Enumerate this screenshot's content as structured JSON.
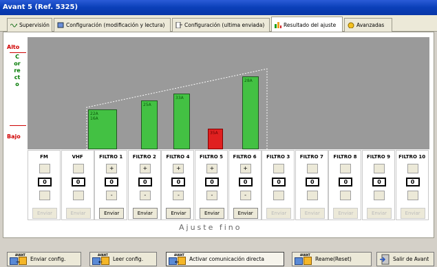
{
  "window": {
    "title": "Avant 5 (Ref. 5325)"
  },
  "tabs": [
    {
      "label": "Supervisión",
      "icon": "wave-icon",
      "active": false
    },
    {
      "label": "Configuración (modificación y lectura)",
      "icon": "config-icon",
      "active": false
    },
    {
      "label": "Configuración (ultima enviada)",
      "icon": "sent-config-icon",
      "active": false
    },
    {
      "label": "Resultado del ajuste",
      "icon": "bar-chart-icon",
      "active": true
    },
    {
      "label": "Avanzadas",
      "icon": "advanced-icon",
      "active": false
    }
  ],
  "levels": {
    "high": "Alto",
    "correct": "Correcto",
    "low": "Bajo"
  },
  "colors": {
    "green_bar": "#43c143",
    "red_bar": "#e02020",
    "chart_bg": "#9a9a9a",
    "titlebar": "#0a3fb8"
  },
  "bars": [
    {
      "label": "22A\n16A",
      "color": "green"
    },
    {
      "label": "25A",
      "color": "green"
    },
    {
      "label": "33A",
      "color": "green"
    },
    {
      "label": "35A",
      "color": "red"
    },
    {
      "label": "28A",
      "color": "green"
    }
  ],
  "channels": [
    {
      "name": "FM",
      "value": "0",
      "enabled": false,
      "plus": "+",
      "minus": "-"
    },
    {
      "name": "VHF",
      "value": "0",
      "enabled": false,
      "plus": "+",
      "minus": "-"
    },
    {
      "name": "FILTRO 1",
      "value": "0",
      "enabled": true,
      "plus": "+",
      "minus": "-"
    },
    {
      "name": "FILTRO 2",
      "value": "0",
      "enabled": true,
      "plus": "+",
      "minus": "-"
    },
    {
      "name": "FILTRO 4",
      "value": "0",
      "enabled": true,
      "plus": "+",
      "minus": "-"
    },
    {
      "name": "FILTRO 5",
      "value": "0",
      "enabled": true,
      "plus": "+",
      "minus": "-"
    },
    {
      "name": "FILTRO 6",
      "value": "0",
      "enabled": true,
      "plus": "+",
      "minus": "-"
    },
    {
      "name": "FILTRO 3",
      "value": "0",
      "enabled": false,
      "plus": "+",
      "minus": "-"
    },
    {
      "name": "FILTRO 7",
      "value": "0",
      "enabled": false,
      "plus": "+",
      "minus": "-"
    },
    {
      "name": "FILTRO 8",
      "value": "0",
      "enabled": false,
      "plus": "+",
      "minus": "-"
    },
    {
      "name": "FILTRO 9",
      "value": "0",
      "enabled": false,
      "plus": "+",
      "minus": "-"
    },
    {
      "name": "FILTRO 10",
      "value": "0",
      "enabled": false,
      "plus": "+",
      "minus": "-"
    }
  ],
  "send_label": "Enviar",
  "fine_tune_label": "Ajuste fino",
  "bottom_buttons": [
    {
      "label": "Enviar config.",
      "icon": "send-config-icon",
      "tag": "AVANT"
    },
    {
      "label": "Leer config.",
      "icon": "read-config-icon",
      "tag": "AVANT"
    },
    {
      "label": "Activar comunicación directa",
      "icon": "direct-comm-icon",
      "tag": "AVANT"
    },
    {
      "label": "Reame(Reset)",
      "icon": "reset-icon",
      "tag": "AVANT"
    },
    {
      "label": "Salir de Avant",
      "icon": "exit-icon",
      "tag": ""
    }
  ]
}
